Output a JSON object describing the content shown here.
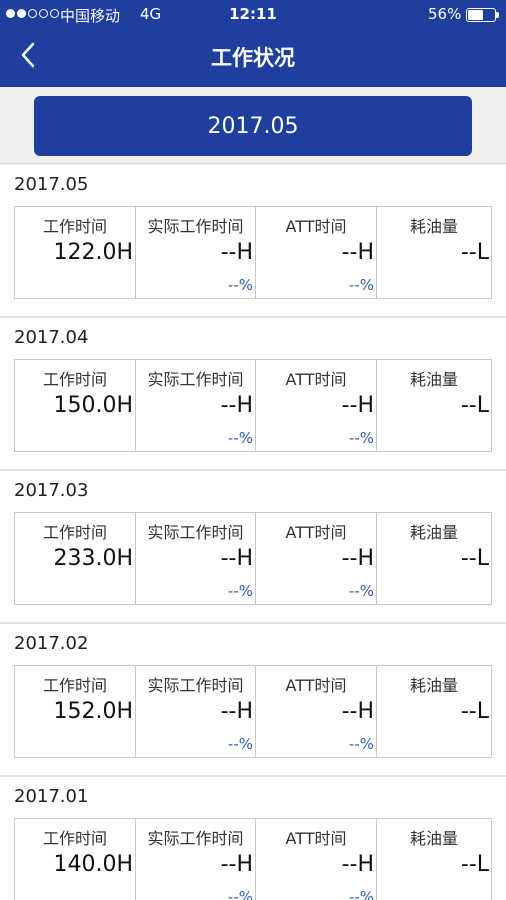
{
  "status_bar": {
    "carrier": "中国移动",
    "network": "4G",
    "time": "12:11",
    "battery": "56%"
  },
  "header": {
    "title": "工作状况",
    "back_icon": "chevron-left-icon"
  },
  "filter": {
    "selected_month": "2017.05"
  },
  "columns": {
    "work_time": "工作时间",
    "actual_work_time": "实际工作时间",
    "att_time": "ATT时间",
    "fuel": "耗油量"
  },
  "records": [
    {
      "month": "2017.05",
      "work_time": "122.0H",
      "actual_work_time": "--H",
      "actual_pct": "--%",
      "att_time": "--H",
      "att_pct": "--%",
      "fuel": "--L"
    },
    {
      "month": "2017.04",
      "work_time": "150.0H",
      "actual_work_time": "--H",
      "actual_pct": "--%",
      "att_time": "--H",
      "att_pct": "--%",
      "fuel": "--L"
    },
    {
      "month": "2017.03",
      "work_time": "233.0H",
      "actual_work_time": "--H",
      "actual_pct": "--%",
      "att_time": "--H",
      "att_pct": "--%",
      "fuel": "--L"
    },
    {
      "month": "2017.02",
      "work_time": "152.0H",
      "actual_work_time": "--H",
      "actual_pct": "--%",
      "att_time": "--H",
      "att_pct": "--%",
      "fuel": "--L"
    },
    {
      "month": "2017.01",
      "work_time": "140.0H",
      "actual_work_time": "--H",
      "actual_pct": "--%",
      "att_time": "--H",
      "att_pct": "--%",
      "fuel": "--L"
    }
  ],
  "colors": {
    "primary": "#1e3f9e",
    "percent_text": "#2d5fae"
  }
}
